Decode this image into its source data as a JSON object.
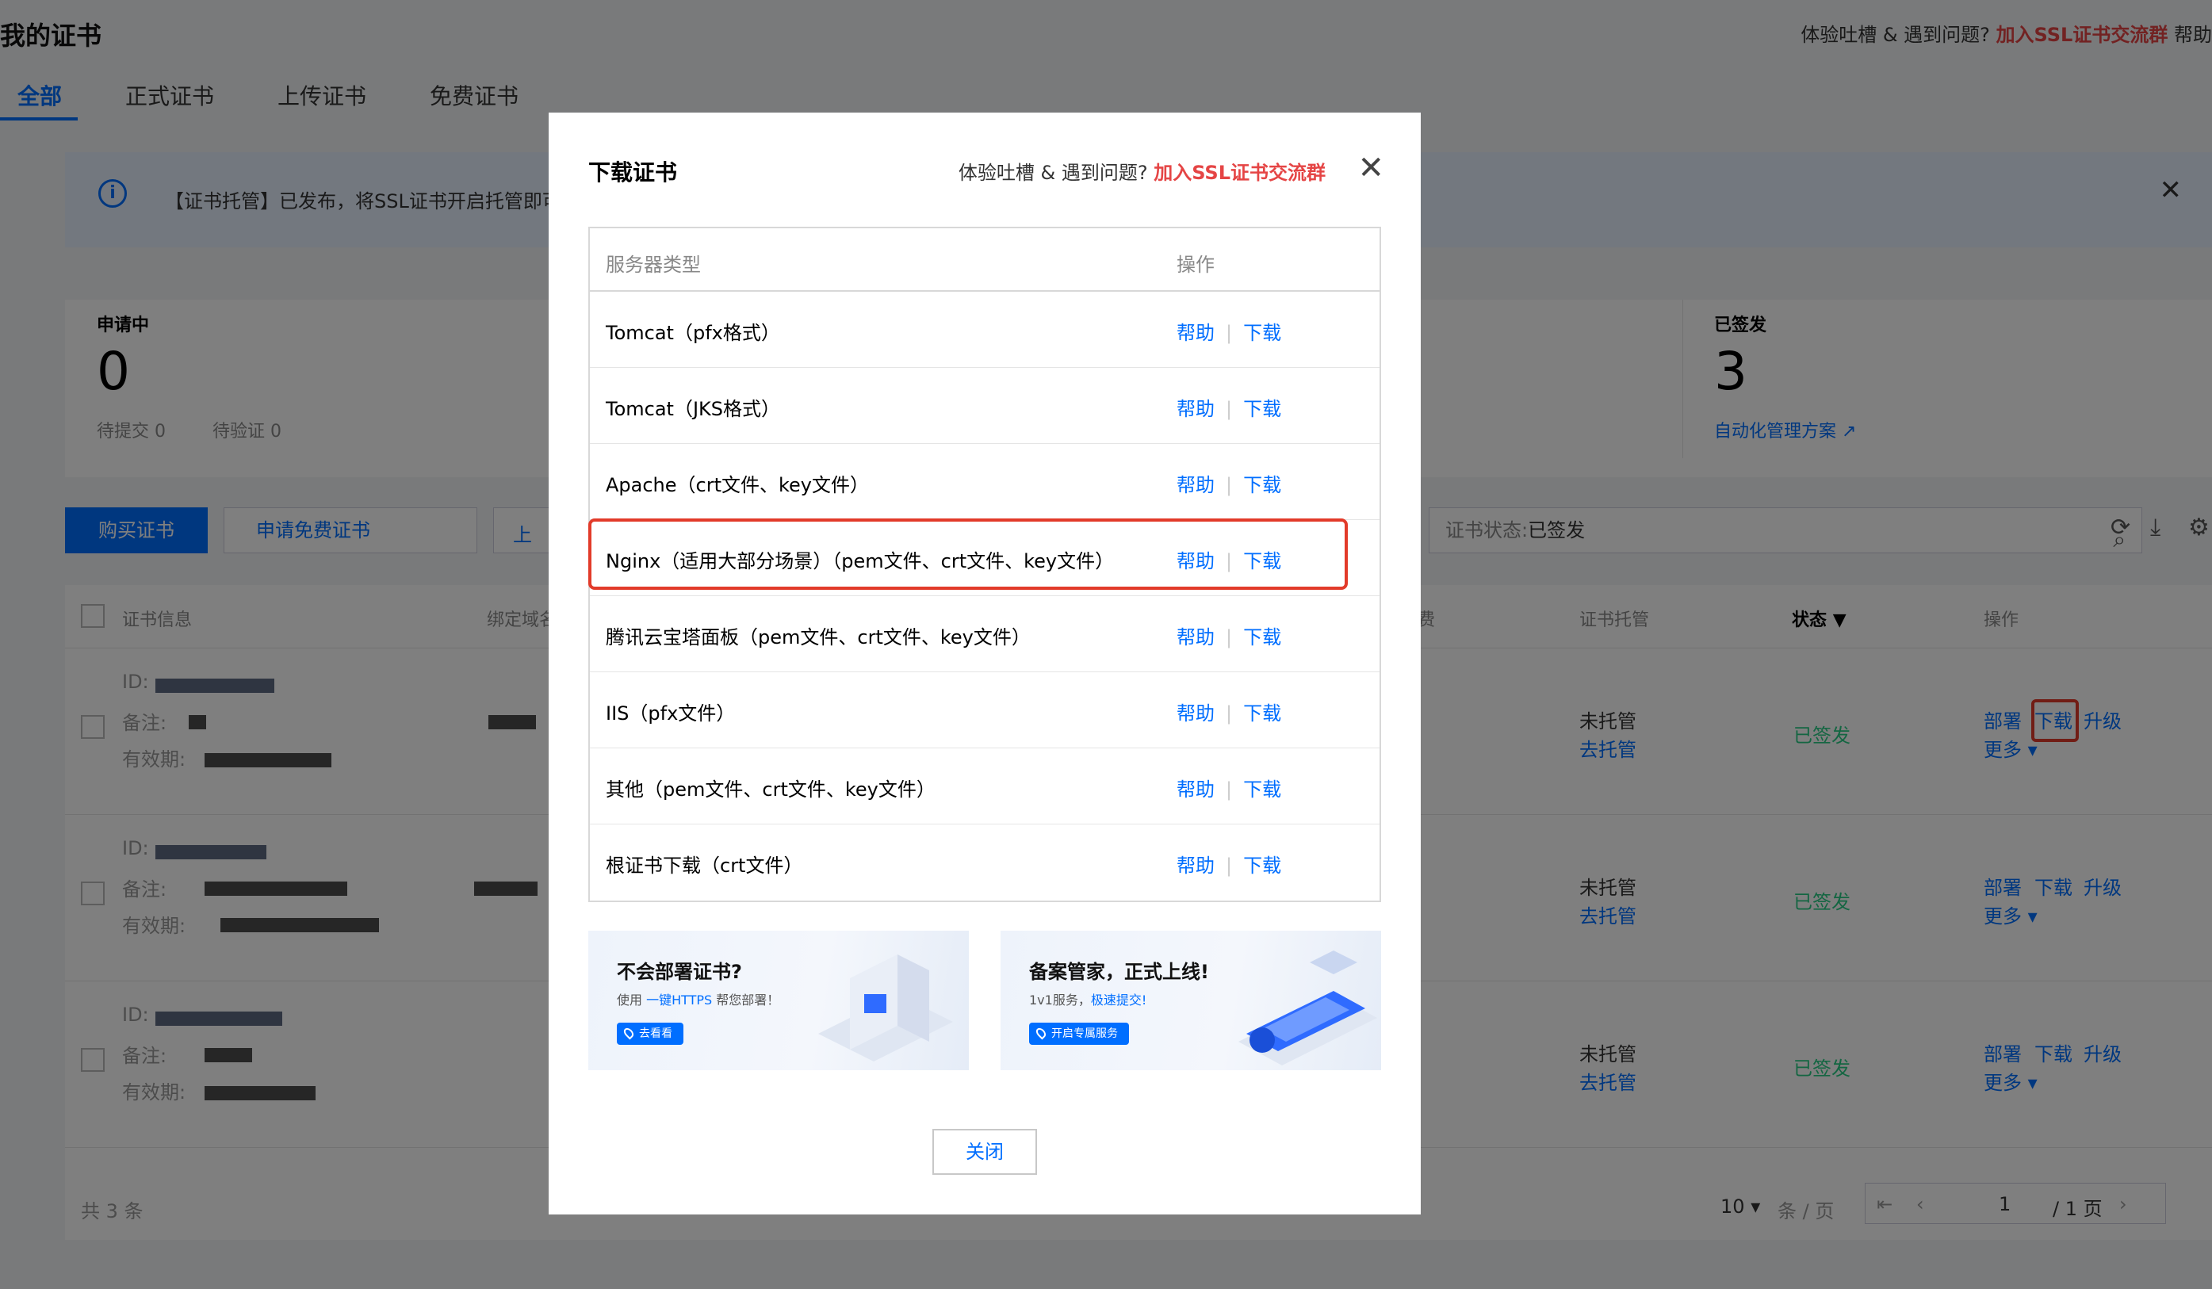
{
  "page": {
    "title": "我的证书",
    "help_prefix": "体验吐槽 & 遇到问题?",
    "help_link": "加入SSL证书交流群",
    "help_more": "帮助",
    "tabs": [
      "全部",
      "正式证书",
      "上传证书",
      "免费证书"
    ],
    "notice": "【证书托管】已发布，将SSL证书开启托管即可",
    "stats": {
      "pending_label": "申请中",
      "pending_count": "0",
      "pending_sub1": "待提交 0",
      "pending_sub2": "待验证 0",
      "issued_label": "已签发",
      "issued_count": "3",
      "issued_link": "自动化管理方案"
    },
    "toolbar": {
      "buy": "购买证书",
      "apply_free": "申请免费证书",
      "upload_cut": "上",
      "filter_label": "证书状态:",
      "filter_value": "已签发"
    },
    "table": {
      "headers": {
        "info": "证书信息",
        "domain": "绑定域名",
        "fee": "费",
        "hosting": "证书托管",
        "status": "状态",
        "ops": "操作"
      },
      "row_labels": {
        "id": "ID:",
        "remark": "备注:",
        "valid": "有效期:"
      },
      "rows": [
        {
          "hosting": "未托管",
          "host_link": "去托管",
          "status": "已签发",
          "ops": [
            "部署",
            "下载",
            "升级"
          ],
          "more": "更多"
        },
        {
          "hosting": "未托管",
          "host_link": "去托管",
          "status": "已签发",
          "ops": [
            "部署",
            "下载",
            "升级"
          ],
          "more": "更多"
        },
        {
          "hosting": "未托管",
          "host_link": "去托管",
          "status": "已签发",
          "ops": [
            "部署",
            "下载",
            "升级"
          ],
          "more": "更多"
        }
      ],
      "footer": {
        "total": "共 3 条",
        "page_size": "10",
        "page_size_unit": "条 / 页",
        "page": "1",
        "page_total": "/ 1 页"
      }
    }
  },
  "dialog": {
    "title": "下载证书",
    "help_prefix": "体验吐槽 & 遇到问题?",
    "help_link": "加入SSL证书交流群",
    "col_type": "服务器类型",
    "col_ops": "操作",
    "help_label": "帮助",
    "download_label": "下载",
    "rows": [
      "Tomcat（pfx格式）",
      "Tomcat（JKS格式）",
      "Apache（crt文件、key文件）",
      "Nginx（适用大部分场景）（pem文件、crt文件、key文件）",
      "腾讯云宝塔面板（pem文件、crt文件、key文件）",
      "IIS（pfx文件）",
      "其他（pem文件、crt文件、key文件）",
      "根证书下载（crt文件）"
    ],
    "banners": [
      {
        "title": "不会部署证书?",
        "sub_prefix": "使用 ",
        "sub_link": "一键HTTPS",
        "sub_suffix": " 帮您部署！",
        "button": "去看看"
      },
      {
        "title": "备案管家，正式上线!",
        "sub_prefix": "1v1服务，",
        "sub_link": "极速提交!",
        "sub_suffix": "",
        "button": "开启专属服务"
      }
    ],
    "close_button": "关闭"
  },
  "colors": {
    "primary": "#006eff",
    "danger": "#e54545",
    "success": "#29cc85",
    "highlight": "#e23b2a"
  }
}
